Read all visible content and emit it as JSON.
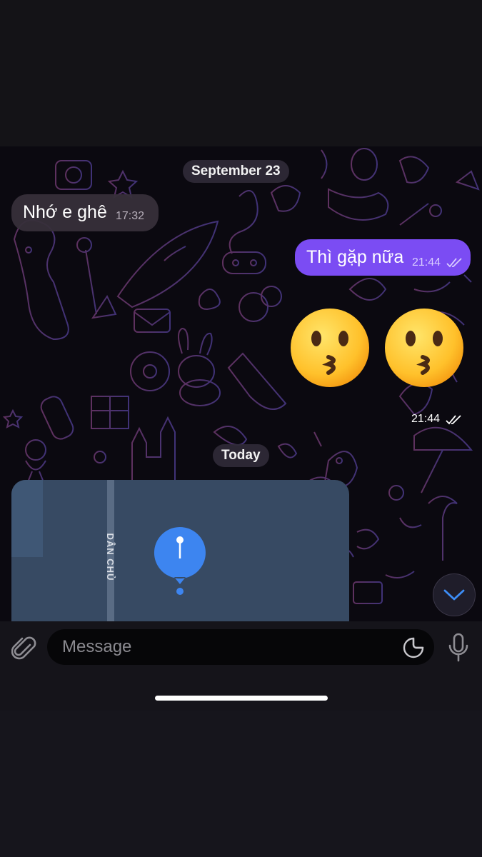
{
  "chat": {
    "date_separator_1": "September 23",
    "date_separator_2": "Today",
    "messages": [
      {
        "direction": "incoming",
        "text": "Nhớ e ghê",
        "time": "17:32"
      },
      {
        "direction": "outgoing",
        "text": "Thì gặp nữa",
        "time": "21:44",
        "status": "read"
      },
      {
        "direction": "outgoing",
        "emoji": "kissing-face",
        "count": 2,
        "time": "21:44",
        "status": "read"
      }
    ],
    "location": {
      "street_label": "DÂN CHỦ"
    }
  },
  "composer": {
    "placeholder": "Message"
  },
  "colors": {
    "outgoing_bubble": "#7b4cf3",
    "incoming_bubble": "#372f3a",
    "map_pin": "#3d85f0",
    "scroll_arrow": "#3d8ef7"
  }
}
